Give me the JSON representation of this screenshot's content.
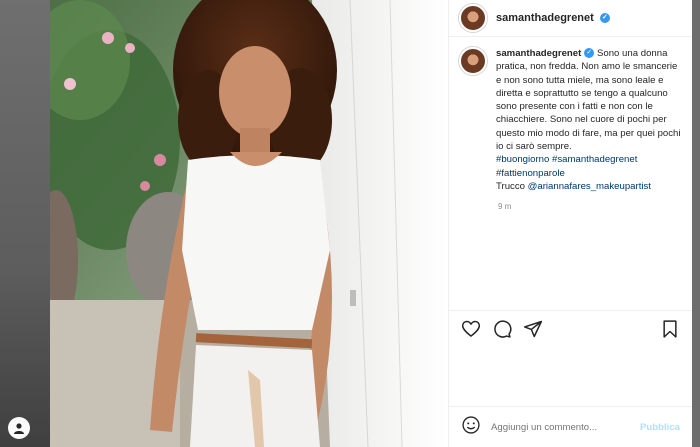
{
  "post": {
    "username": "samanthadegrenet",
    "verified": true,
    "caption": "Sono una donna pratica, non fredda. Non amo le smancerie e non sono tutta miele, ma sono leale e diretta e soprattutto se tengo a qualcuno sono presente con i fatti e non con le chiacchiere. Sono nel cuore di pochi per questo mio modo di fare, ma per quei pochi io ci sarò sempre.",
    "hashtags": {
      "tag1": "#buongiorno",
      "tag2": "#samanthadegrenet",
      "tag3": "#fattienonparole"
    },
    "credit_prefix": "Trucco ",
    "credit_mention": "@ariannafares_makeupartist",
    "time": "9 m"
  },
  "comment": {
    "placeholder": "Aggiungi un commento...",
    "publish_label": "Pubblica"
  },
  "colors": {
    "link": "#00376b",
    "verified": "#3897f0",
    "publish_disabled": "#b2dffc"
  },
  "icons": [
    "heart-icon",
    "comment-icon",
    "share-icon",
    "bookmark-icon",
    "emoji-icon",
    "verified-badge-icon",
    "profile-icon"
  ]
}
